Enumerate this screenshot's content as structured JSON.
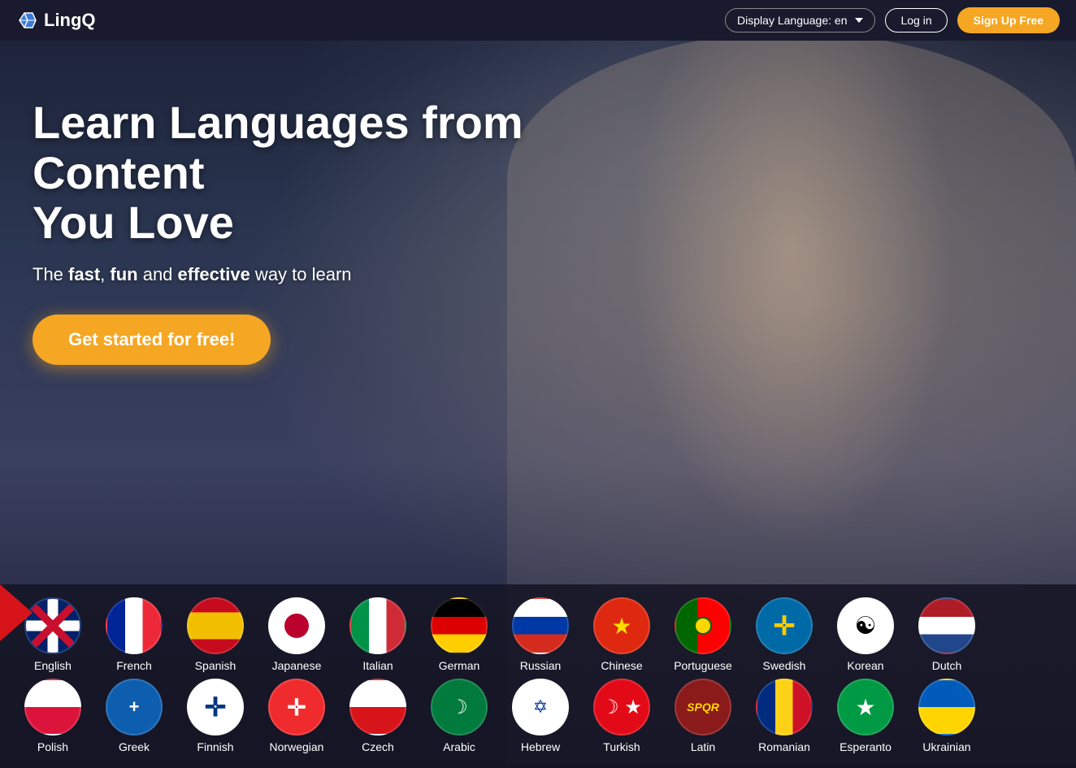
{
  "header": {
    "logo_text": "LingQ",
    "display_language_label": "Display Language: en",
    "login_label": "Log in",
    "signup_label": "Sign Up Free"
  },
  "hero": {
    "title_line1": "Learn Languages from Content",
    "title_line2": "You Love",
    "subtitle_pre": "The ",
    "subtitle_fast": "fast",
    "subtitle_comma": ", ",
    "subtitle_fun": "fun",
    "subtitle_and": " and ",
    "subtitle_effective": "effective",
    "subtitle_post": " way to learn",
    "cta_button": "Get started for free!"
  },
  "languages_row1": [
    {
      "id": "english",
      "label": "English",
      "flag_class": "flag-uk"
    },
    {
      "id": "french",
      "label": "French",
      "flag_class": "flag-fr"
    },
    {
      "id": "spanish",
      "label": "Spanish",
      "flag_class": "flag-es"
    },
    {
      "id": "japanese",
      "label": "Japanese",
      "flag_class": "flag-jp"
    },
    {
      "id": "italian",
      "label": "Italian",
      "flag_class": "flag-it"
    },
    {
      "id": "german",
      "label": "German",
      "flag_class": "flag-de"
    },
    {
      "id": "russian",
      "label": "Russian",
      "flag_class": "flag-ru"
    },
    {
      "id": "chinese",
      "label": "Chinese",
      "flag_class": "flag-cn"
    },
    {
      "id": "portuguese",
      "label": "Portuguese",
      "flag_class": "flag-pt"
    },
    {
      "id": "swedish",
      "label": "Swedish",
      "flag_class": "flag-se"
    },
    {
      "id": "korean",
      "label": "Korean",
      "flag_class": "flag-kr"
    },
    {
      "id": "dutch",
      "label": "Dutch",
      "flag_class": "flag-nl"
    }
  ],
  "languages_row2": [
    {
      "id": "polish",
      "label": "Polish",
      "flag_class": "flag-pl"
    },
    {
      "id": "greek",
      "label": "Greek",
      "flag_class": "flag-gr"
    },
    {
      "id": "finnish",
      "label": "Finnish",
      "flag_class": "flag-fi"
    },
    {
      "id": "norwegian",
      "label": "Norwegian",
      "flag_class": "flag-no"
    },
    {
      "id": "czech",
      "label": "Czech",
      "flag_class": "flag-cz"
    },
    {
      "id": "arabic",
      "label": "Arabic",
      "flag_class": "flag-ar"
    },
    {
      "id": "hebrew",
      "label": "Hebrew",
      "flag_class": "flag-he"
    },
    {
      "id": "turkish",
      "label": "Turkish",
      "flag_class": "flag-tr"
    },
    {
      "id": "latin",
      "label": "Latin",
      "flag_class": "flag-la"
    },
    {
      "id": "romanian",
      "label": "Romanian",
      "flag_class": "flag-ro"
    },
    {
      "id": "esperanto",
      "label": "Esperanto",
      "flag_class": "flag-eo"
    },
    {
      "id": "ukrainian",
      "label": "Ukrainian",
      "flag_class": "flag-uk2"
    }
  ]
}
